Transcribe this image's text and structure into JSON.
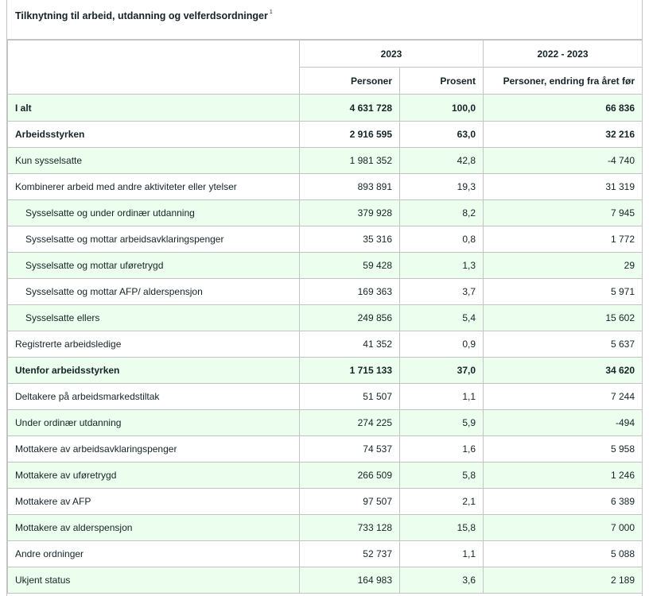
{
  "table": {
    "caption": "Tilknytning til arbeid, utdanning og velferdsordninger",
    "footnote_marker": "1",
    "header": {
      "year_label": "2023",
      "change_label": "2022 - 2023",
      "col_persons": "Personer",
      "col_percent": "Prosent",
      "col_change": "Personer, endring fra året før"
    },
    "rows": [
      {
        "label": "I alt",
        "persons": "4 631 728",
        "percent": "100,0",
        "change": "66 836",
        "bold": true,
        "indent": false
      },
      {
        "label": "Arbeidsstyrken",
        "persons": "2 916 595",
        "percent": "63,0",
        "change": "32 216",
        "bold": true,
        "indent": false
      },
      {
        "label": "Kun sysselsatte",
        "persons": "1 981 352",
        "percent": "42,8",
        "change": "-4 740",
        "bold": false,
        "indent": false
      },
      {
        "label": "Kombinerer arbeid med andre aktiviteter eller ytelser",
        "persons": "893 891",
        "percent": "19,3",
        "change": "31 319",
        "bold": false,
        "indent": false
      },
      {
        "label": "Sysselsatte og under ordinær utdanning",
        "persons": "379 928",
        "percent": "8,2",
        "change": "7 945",
        "bold": false,
        "indent": true
      },
      {
        "label": "Sysselsatte og mottar arbeidsavklaringspenger",
        "persons": "35 316",
        "percent": "0,8",
        "change": "1 772",
        "bold": false,
        "indent": true
      },
      {
        "label": "Sysselsatte og mottar uføretrygd",
        "persons": "59 428",
        "percent": "1,3",
        "change": "29",
        "bold": false,
        "indent": true
      },
      {
        "label": "Sysselsatte og mottar AFP/ alderspensjon",
        "persons": "169 363",
        "percent": "3,7",
        "change": "5 971",
        "bold": false,
        "indent": true
      },
      {
        "label": "Sysselsatte ellers",
        "persons": "249 856",
        "percent": "5,4",
        "change": "15 602",
        "bold": false,
        "indent": true
      },
      {
        "label": "Registrerte arbeidsledige",
        "persons": "41 352",
        "percent": "0,9",
        "change": "5 637",
        "bold": false,
        "indent": false
      },
      {
        "label": "Utenfor arbeidsstyrken",
        "persons": "1 715 133",
        "percent": "37,0",
        "change": "34 620",
        "bold": true,
        "indent": false
      },
      {
        "label": "Deltakere på arbeidsmarkedstiltak",
        "persons": "51 507",
        "percent": "1,1",
        "change": "7 244",
        "bold": false,
        "indent": false
      },
      {
        "label": "Under ordinær utdanning",
        "persons": "274 225",
        "percent": "5,9",
        "change": "-494",
        "bold": false,
        "indent": false
      },
      {
        "label": "Mottakere av arbeidsavklaringspenger",
        "persons": "74 537",
        "percent": "1,6",
        "change": "5 958",
        "bold": false,
        "indent": false
      },
      {
        "label": "Mottakere av uføretrygd",
        "persons": "266 509",
        "percent": "5,8",
        "change": "1 246",
        "bold": false,
        "indent": false
      },
      {
        "label": "Mottakere av AFP",
        "persons": "97 507",
        "percent": "2,1",
        "change": "6 389",
        "bold": false,
        "indent": false
      },
      {
        "label": "Mottakere av alderspensjon",
        "persons": "733 128",
        "percent": "15,8",
        "change": "7 000",
        "bold": false,
        "indent": false
      },
      {
        "label": "Andre ordninger",
        "persons": "52 737",
        "percent": "1,1",
        "change": "5 088",
        "bold": false,
        "indent": false
      },
      {
        "label": "Ukjent status",
        "persons": "164 983",
        "percent": "3,6",
        "change": "2 189",
        "bold": false,
        "indent": false
      }
    ]
  }
}
